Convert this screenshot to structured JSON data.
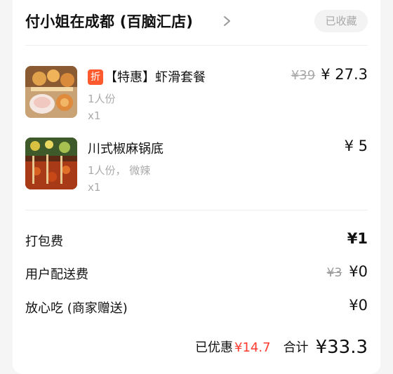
{
  "store": {
    "name": "付小姐在成都 (百脑汇店)",
    "favorite_label": "已收藏"
  },
  "items": [
    {
      "tag": "折",
      "title": "【特惠】虾滑套餐",
      "portion": "1人份",
      "qty": "x1",
      "original_price": "¥39",
      "price": "¥ 27.3"
    },
    {
      "title": "川式椒麻锅底",
      "portion": "1人份， 微辣",
      "qty": "x1",
      "price": "¥ 5"
    }
  ],
  "fees": [
    {
      "label": "打包费",
      "value": "¥1"
    },
    {
      "label": "用户配送费",
      "original": "¥3",
      "value": "¥0"
    },
    {
      "label": "放心吃 (商家赠送)",
      "value": "¥0"
    }
  ],
  "summary": {
    "discount_label": "已优惠",
    "discount_value": "¥14.7",
    "total_label": "合计",
    "total_value": "¥33.3"
  },
  "colors": {
    "accent_red": "#ff3a2f",
    "tag_orange": "#ff5a2d"
  }
}
